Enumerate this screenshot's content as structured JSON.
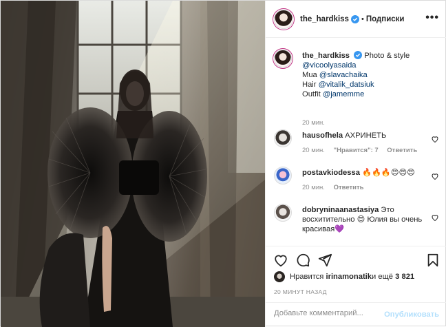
{
  "header": {
    "username": "the_hardkiss",
    "separator": "•",
    "follow_status": "Подписки",
    "more_label": "•••"
  },
  "caption": {
    "username": "the_hardkiss",
    "text": "Photo & style",
    "mentions": [
      "@vicoolyasaida"
    ],
    "lines": [
      {
        "prefix": "Mua ",
        "mention": "@slavachaika"
      },
      {
        "prefix": "Hair ",
        "mention": "@vitalik_datsiuk"
      },
      {
        "prefix": "Outfit ",
        "mention": "@jamemme"
      }
    ],
    "time": "20 мин."
  },
  "comments": [
    {
      "username": "hausofhela",
      "text": "АХРИНЕТЬ",
      "time": "20 мин.",
      "likes": "\"Нравится\": 7",
      "reply": "Ответить"
    },
    {
      "username": "postavkiodessa",
      "text": "🔥🔥🔥😍😍😍",
      "time": "20 мин.",
      "reply": "Ответить"
    },
    {
      "username": "dobryninaanastasiya",
      "text": "Это восхитительно 😍 Юлия вы очень красивая💜",
      "time": "",
      "reply": ""
    }
  ],
  "likes": {
    "prefix": "Нравится ",
    "user": "irinamonatik",
    "middle": " и ещё ",
    "count": "3 821"
  },
  "timestamp": "20 минут назад",
  "comment_box": {
    "placeholder": "Добавьте комментарий...",
    "post_label": "Опубликовать"
  },
  "icons": [
    "verified-icon",
    "heart-icon",
    "comment-icon",
    "share-icon",
    "bookmark-icon",
    "more-icon"
  ],
  "colors": {
    "link": "#00376b",
    "meta": "#8e8e8e",
    "verified": "#3897f0",
    "post_button": "#b2dffc"
  }
}
